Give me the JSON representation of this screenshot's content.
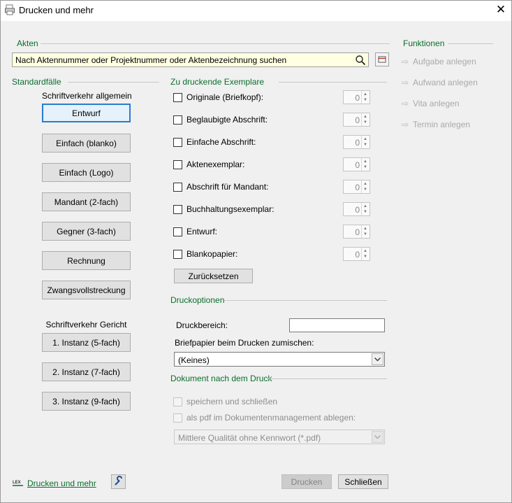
{
  "window": {
    "title": "Drucken und mehr"
  },
  "akten": {
    "label": "Akten",
    "search_value": "Nach Aktennummer oder Projektnummer oder Aktenbezeichnung suchen"
  },
  "funktionen": {
    "label": "Funktionen",
    "items": [
      "Aufgabe anlegen",
      "Aufwand anlegen",
      "Vita anlegen",
      "Termin anlegen"
    ]
  },
  "standardfaelle": {
    "label": "Standardfälle",
    "allgemein_heading": "Schriftverkehr allgemein",
    "allgemein_buttons": [
      "Entwurf",
      "Einfach (blanko)",
      "Einfach (Logo)",
      "Mandant (2-fach)",
      "Gegner (3-fach)",
      "Rechnung",
      "Zwangsvollstreckung"
    ],
    "gericht_heading": "Schriftverkehr Gericht",
    "gericht_buttons": [
      "1. Instanz (5-fach)",
      "2. Instanz (7-fach)",
      "3. Instanz (9-fach)"
    ]
  },
  "exemplare": {
    "label": "Zu druckende Exemplare",
    "items": [
      {
        "label": "Originale (Briefkopf):",
        "count": "0"
      },
      {
        "label": "Beglaubigte Abschrift:",
        "count": "0"
      },
      {
        "label": "Einfache Abschrift:",
        "count": "0"
      },
      {
        "label": "Aktenexemplar:",
        "count": "0"
      },
      {
        "label": "Abschrift für Mandant:",
        "count": "0"
      },
      {
        "label": "Buchhaltungsexemplar:",
        "count": "0"
      },
      {
        "label": "Entwurf:",
        "count": "0"
      },
      {
        "label": "Blankopapier:",
        "count": "0"
      }
    ],
    "reset_label": "Zurücksetzen"
  },
  "druckoptionen": {
    "label": "Druckoptionen",
    "druckbereich_label": "Druckbereich:",
    "druckbereich_value": "",
    "briefpapier_label": "Briefpapier beim Drucken zumischen:",
    "briefpapier_value": "(Keines)"
  },
  "nach_druck": {
    "label": "Dokument nach dem Druck",
    "save_close": "speichern und schließen",
    "pdf_dms": "als pdf im Dokumentenmanagement ablegen:",
    "quality_value": "Mittlere Qualität ohne Kennwort (*.pdf)"
  },
  "footer": {
    "link": "Drucken und mehr",
    "print_label": "Drucken",
    "close_label": "Schließen"
  },
  "colors": {
    "section_green": "#0b6e2c",
    "search_bg": "#ffffe1",
    "default_button_border": "#2a7bd0"
  }
}
